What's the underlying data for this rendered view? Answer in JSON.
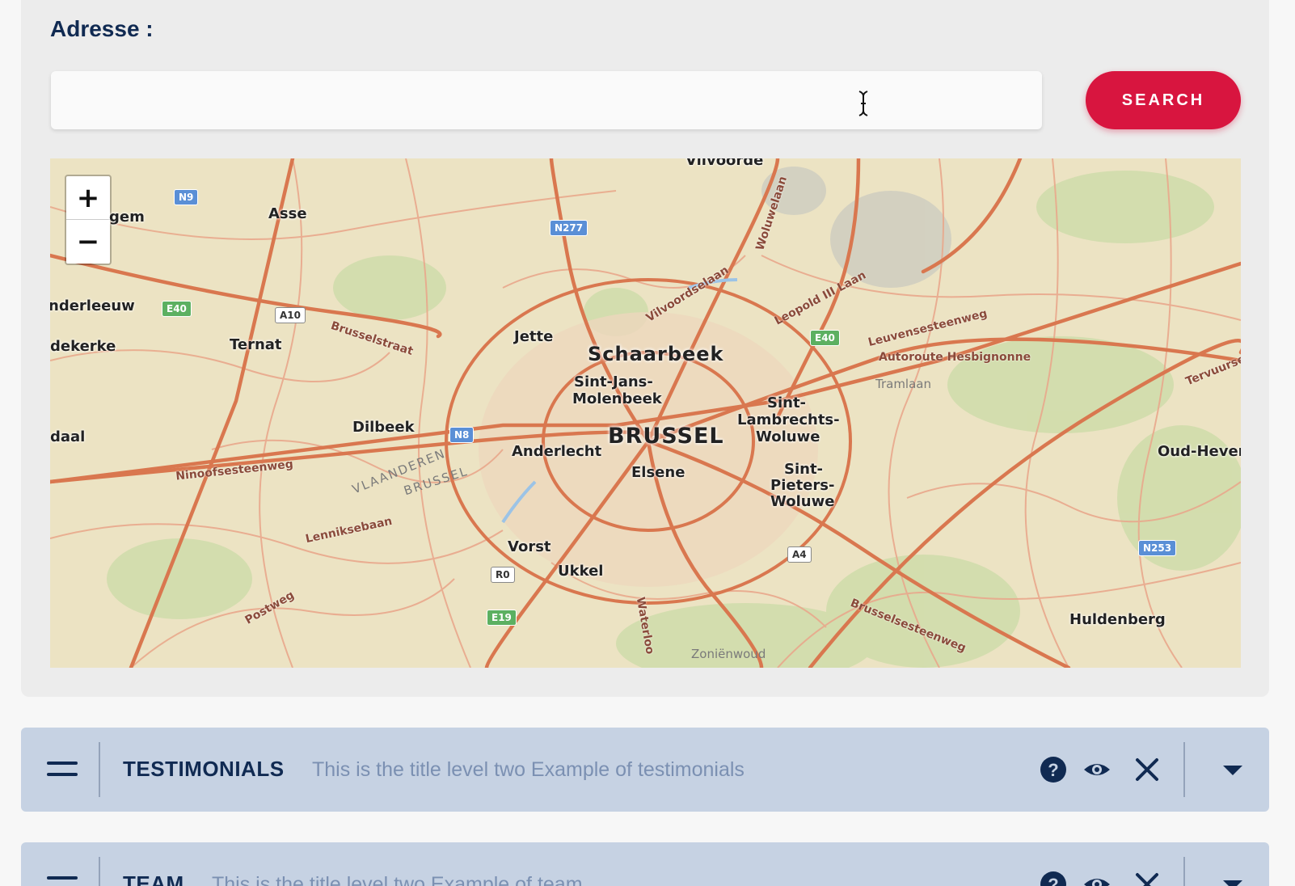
{
  "address": {
    "label": "Adresse :",
    "input_value": "",
    "input_placeholder": "",
    "search_label": "SEARCH"
  },
  "map": {
    "zoom_in_label": "+",
    "zoom_out_label": "−",
    "places": [
      {
        "name": "Vilvoorde",
        "kind": "city"
      },
      {
        "name": "Asse",
        "kind": "city"
      },
      {
        "name": "gem",
        "kind": "city"
      },
      {
        "name": "nderleeuw",
        "kind": "city"
      },
      {
        "name": "dekerke",
        "kind": "city"
      },
      {
        "name": "Ternat",
        "kind": "city"
      },
      {
        "name": "Jette",
        "kind": "city"
      },
      {
        "name": "Schaarbeek",
        "kind": "city-large"
      },
      {
        "name": "Sint-Jans-",
        "kind": "city"
      },
      {
        "name": "Molenbeek",
        "kind": "city"
      },
      {
        "name": "BRUSSEL",
        "kind": "capital"
      },
      {
        "name": "Sint-",
        "kind": "city"
      },
      {
        "name": "Lambrechts-",
        "kind": "city"
      },
      {
        "name": "Woluwe",
        "kind": "city"
      },
      {
        "name": "Dilbeek",
        "kind": "city"
      },
      {
        "name": "daal",
        "kind": "city"
      },
      {
        "name": "Anderlecht",
        "kind": "city"
      },
      {
        "name": "Elsene",
        "kind": "city"
      },
      {
        "name": "Sint-",
        "kind": "city"
      },
      {
        "name": "Pieters-",
        "kind": "city"
      },
      {
        "name": "Woluwe",
        "kind": "city"
      },
      {
        "name": "Oud-Hever",
        "kind": "city"
      },
      {
        "name": "Vorst",
        "kind": "city"
      },
      {
        "name": "Ukkel",
        "kind": "city"
      },
      {
        "name": "Huldenberg",
        "kind": "city"
      },
      {
        "name": "Zoniënwoud",
        "kind": "area"
      },
      {
        "name": "Tramlaan",
        "kind": "area"
      },
      {
        "name": "VLAANDEREN",
        "kind": "area"
      },
      {
        "name": "BRUSSEL",
        "kind": "area"
      }
    ],
    "roads": [
      {
        "name": "Ninoofsesteenweg"
      },
      {
        "name": "Lenniksebaan"
      },
      {
        "name": "Brusselstraat"
      },
      {
        "name": "Leuvensesteenweg"
      },
      {
        "name": "Autoroute Hesbignonne"
      },
      {
        "name": "Vilvoordselaan"
      },
      {
        "name": "Woluwelaan"
      },
      {
        "name": "Leopold III Laan"
      },
      {
        "name": "Brusselsesteenweg"
      },
      {
        "name": "Waterloo"
      },
      {
        "name": "Postweg"
      },
      {
        "name": "Tervuursesteenweg"
      }
    ],
    "shields": [
      {
        "ref": "N9",
        "color": "blue"
      },
      {
        "ref": "N277",
        "color": "blue"
      },
      {
        "ref": "E40",
        "color": "green"
      },
      {
        "ref": "A10",
        "color": "white"
      },
      {
        "ref": "E40",
        "color": "green"
      },
      {
        "ref": "N8",
        "color": "blue"
      },
      {
        "ref": "A4",
        "color": "white"
      },
      {
        "ref": "R0",
        "color": "white"
      },
      {
        "ref": "E19",
        "color": "green"
      },
      {
        "ref": "N253",
        "color": "blue"
      }
    ]
  },
  "sections": [
    {
      "title": "TESTIMONIALS",
      "subtitle": "This is the title level two Example of testimonials"
    },
    {
      "title": "TEAM",
      "subtitle": "This is the title level two Example of team"
    }
  ],
  "colors": {
    "accent": "#d8153f",
    "navy": "#102a52",
    "section_bg": "#c6d2e3",
    "subtitle": "#7b90b2"
  },
  "icons": [
    "drag-handle-icon",
    "help-icon",
    "eye-icon",
    "close-icon",
    "caret-down-icon",
    "text-cursor-icon"
  ]
}
